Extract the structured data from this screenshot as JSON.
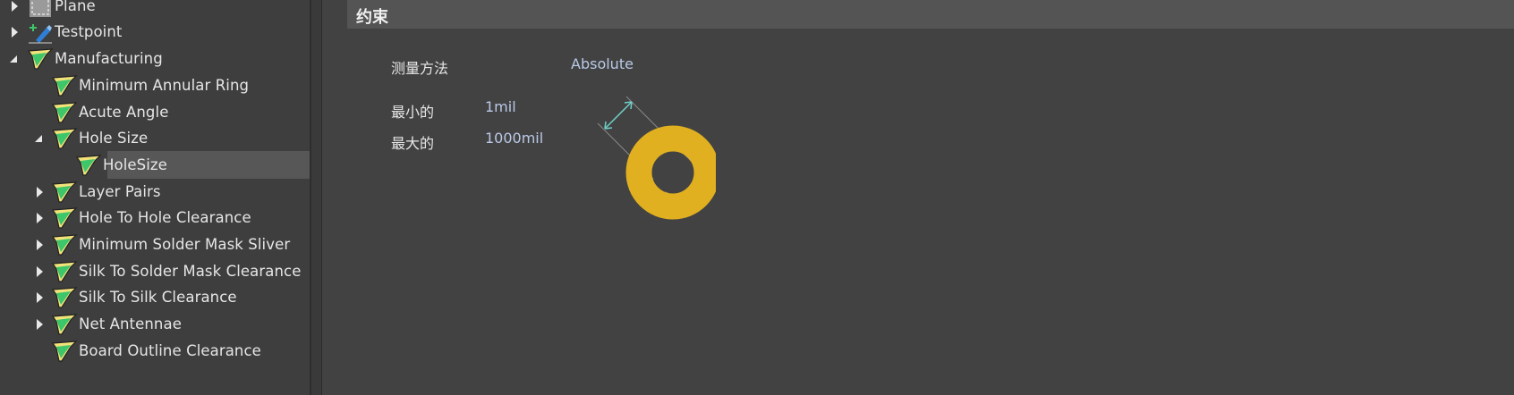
{
  "tree": {
    "items": [
      {
        "label": "Plane",
        "expander": "collapsed",
        "icon": "plane-icon"
      },
      {
        "label": "Testpoint",
        "expander": "collapsed",
        "icon": "testpoint-icon"
      },
      {
        "label": "Manufacturing",
        "expander": "expanded",
        "icon": "rule-icon"
      },
      {
        "label": "Minimum Annular Ring",
        "expander": "none",
        "icon": "rule-icon"
      },
      {
        "label": "Acute Angle",
        "expander": "none",
        "icon": "rule-icon"
      },
      {
        "label": "Hole Size",
        "expander": "expanded",
        "icon": "rule-icon"
      },
      {
        "label": "HoleSize",
        "expander": "none",
        "icon": "rule-icon",
        "selected": true
      },
      {
        "label": "Layer Pairs",
        "expander": "collapsed",
        "icon": "rule-icon"
      },
      {
        "label": "Hole To Hole Clearance",
        "expander": "collapsed",
        "icon": "rule-icon"
      },
      {
        "label": "Minimum Solder Mask Sliver",
        "expander": "collapsed",
        "icon": "rule-icon"
      },
      {
        "label": "Silk To Solder Mask Clearance",
        "expander": "collapsed",
        "icon": "rule-icon"
      },
      {
        "label": "Silk To Silk Clearance",
        "expander": "collapsed",
        "icon": "rule-icon"
      },
      {
        "label": "Net Antennae",
        "expander": "collapsed",
        "icon": "rule-icon"
      },
      {
        "label": "Board Outline Clearance",
        "expander": "none",
        "icon": "rule-icon"
      }
    ]
  },
  "constraints": {
    "section_title": "约束",
    "measure_method_label": "测量方法",
    "measure_method_value": "Absolute",
    "min_label": "最小的",
    "min_value": "1mil",
    "max_label": "最大的",
    "max_value": "1000mil"
  },
  "colors": {
    "pad": "#e0b020",
    "rule_icon_green": "#3ec66a",
    "rule_icon_yellow": "#f2e27a",
    "value_text": "#b9c9e6",
    "dimension_arrow": "#6fd0c8"
  }
}
